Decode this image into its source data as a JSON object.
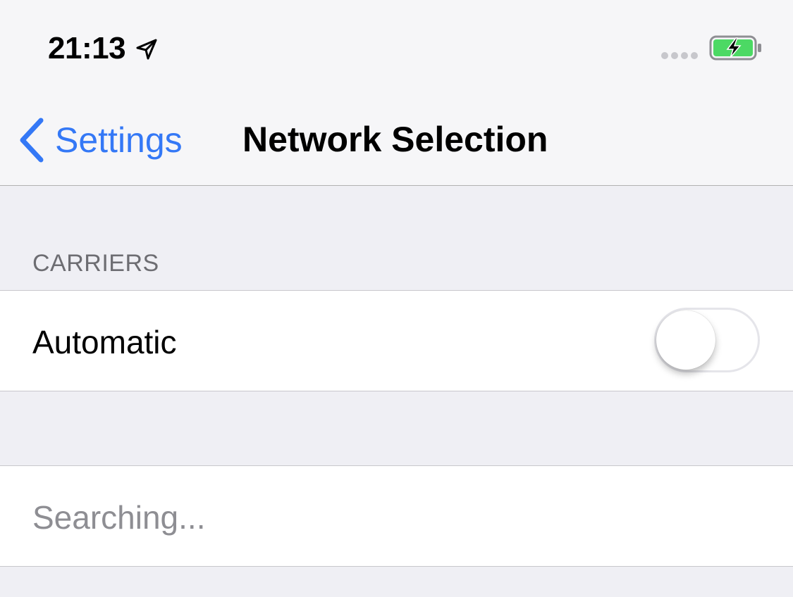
{
  "status_bar": {
    "time": "21:13",
    "location_icon": "location-arrow-icon",
    "signal_icon": "signal-dots-icon",
    "battery_icon": "battery-charging-icon",
    "battery_color": "#4cd964"
  },
  "nav": {
    "back_label": "Settings",
    "back_icon": "chevron-left-icon",
    "title": "Network Selection",
    "accent_color": "#3478f6"
  },
  "sections": {
    "carriers_header": "CARRIERS"
  },
  "cells": {
    "automatic": {
      "label": "Automatic",
      "toggle_on": false
    },
    "searching": {
      "label": "Searching..."
    }
  }
}
